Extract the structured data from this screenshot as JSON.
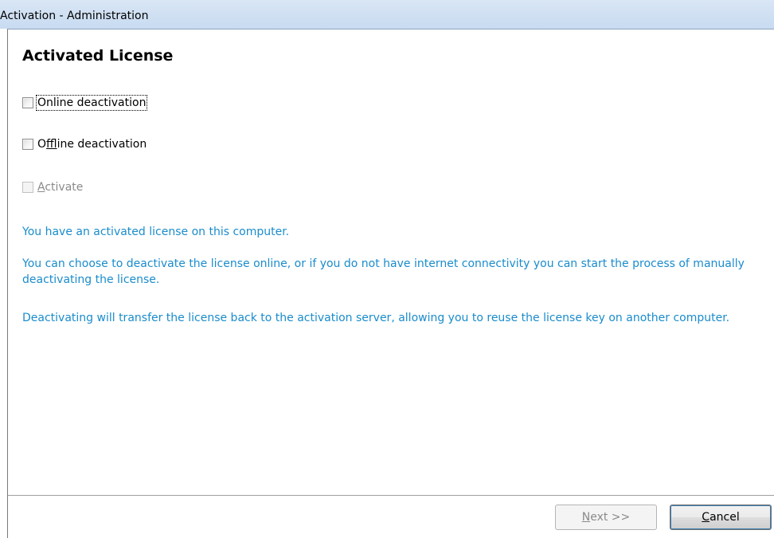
{
  "window": {
    "title": "Activation - Administration"
  },
  "page": {
    "heading": "Activated License"
  },
  "options": {
    "online": {
      "label": "Online deactivation",
      "checked": false,
      "enabled": true,
      "focused": true
    },
    "offline": {
      "label_pre": "O",
      "label_mnemonic": "f",
      "label_post": "fline deactivation",
      "checked": false,
      "enabled": true
    },
    "activate": {
      "label_mnemonic": "A",
      "label_post": "ctivate",
      "checked": false,
      "enabled": false
    }
  },
  "info": {
    "p1": "You have an activated license on this computer.",
    "p2": "You can choose to deactivate the license online, or if you do not have internet connectivity you can start the process of manually deactivating the license.",
    "p3": "Deactivating will transfer the license back to the activation server, allowing you to reuse the license key on another computer."
  },
  "buttons": {
    "next": {
      "mnemonic": "N",
      "rest": "ext >>",
      "enabled": false
    },
    "cancel": {
      "mnemonic": "C",
      "rest": "ancel",
      "enabled": true
    }
  },
  "colors": {
    "info_text": "#1a8ccc",
    "titlebar": "#d9e6f5"
  }
}
